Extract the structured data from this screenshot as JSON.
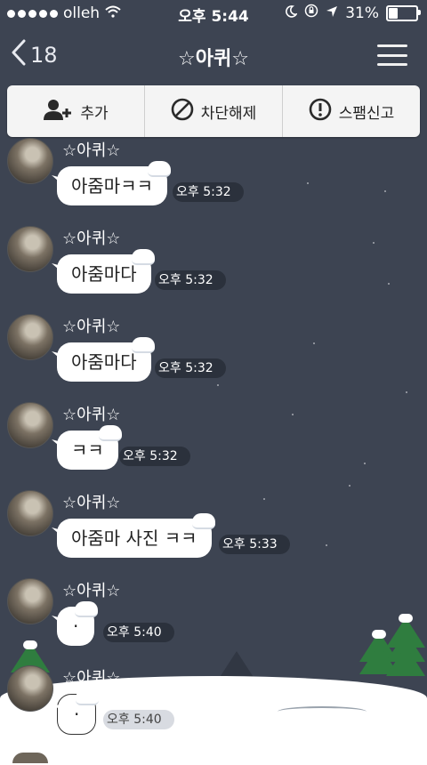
{
  "status_bar": {
    "carrier": "olleh",
    "time": "오후 5:44",
    "battery_percent": "31%",
    "battery_level": 0.31
  },
  "header": {
    "back_count": "18",
    "title": "☆아퀴☆"
  },
  "actions": [
    {
      "label": "추가",
      "icon": "add-friend-icon"
    },
    {
      "label": "차단해제",
      "icon": "block-icon"
    },
    {
      "label": "스팸신고",
      "icon": "warning-icon"
    }
  ],
  "messages": [
    {
      "sender": "☆아퀴☆",
      "text": "아줌마ㅋㅋ",
      "time": "오후 5:32"
    },
    {
      "sender": "☆아퀴☆",
      "text": "아줌마다",
      "time": "오후 5:32"
    },
    {
      "sender": "☆아퀴☆",
      "text": "아줌마다",
      "time": "오후 5:32"
    },
    {
      "sender": "☆아퀴☆",
      "text": "ㅋㅋ",
      "time": "오후 5:32"
    },
    {
      "sender": "☆아퀴☆",
      "text": "아줌마 사진 ㅋㅋ",
      "time": "오후 5:33"
    },
    {
      "sender": "☆아퀴☆",
      "text": "·",
      "time": "오후 5:40"
    },
    {
      "sender": "☆아퀴☆",
      "text": "·",
      "time": "오후 5:40"
    }
  ],
  "colors": {
    "background": "#3d4452",
    "bubble": "#ffffff",
    "action_bar": "#f4f4f4",
    "tree": "#2f7d3f"
  }
}
